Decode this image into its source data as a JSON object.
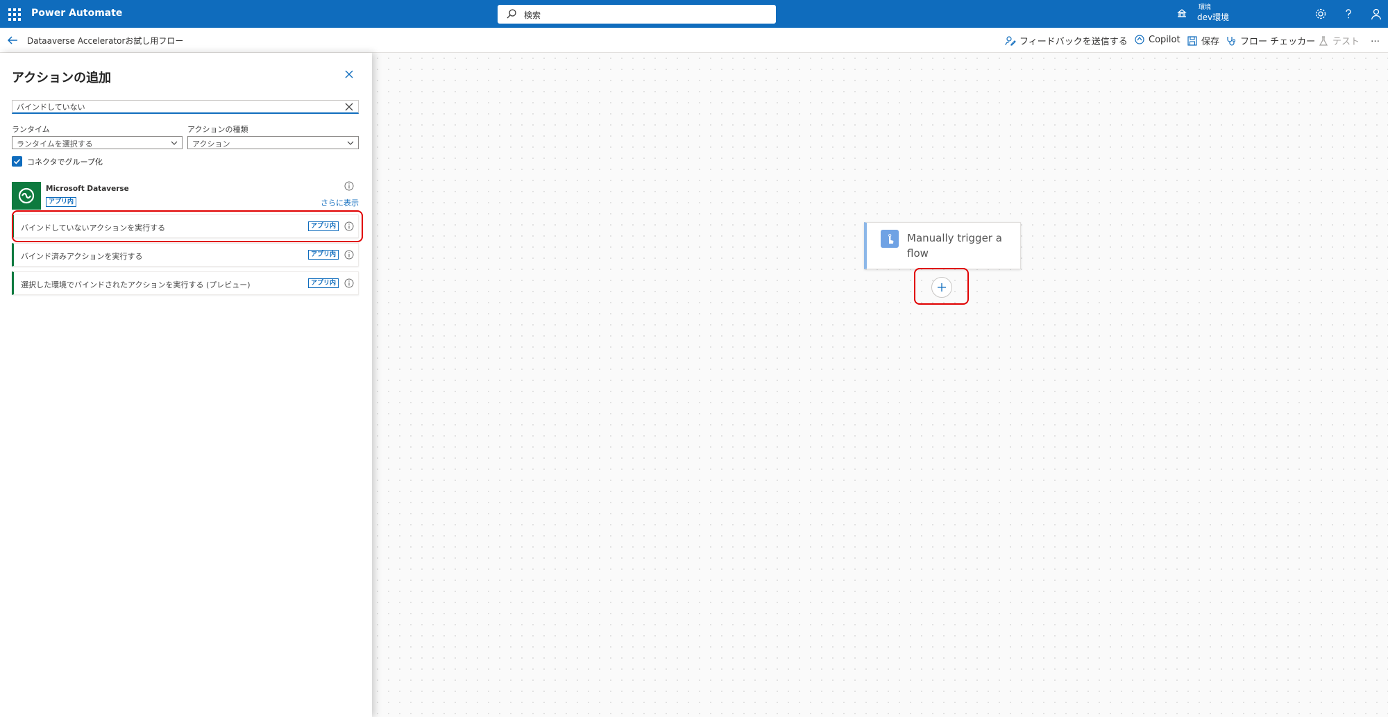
{
  "app": {
    "name": "Power Automate"
  },
  "search": {
    "placeholder": "検索"
  },
  "environment": {
    "label": "環境",
    "name": "dev環境"
  },
  "icons": {
    "waffle": "app-launcher-icon",
    "search": "search-icon",
    "environment": "environment-icon",
    "settings": "gear-icon",
    "help": "help-icon",
    "account": "account-icon"
  },
  "commandbar": {
    "flow_name": "Dataaverse Acceleratorお試し用フロー",
    "feedback": "フィードバックを送信する",
    "copilot": "Copilot",
    "save": "保存",
    "flow_checker": "フロー チェッカー",
    "test": "テスト",
    "more": "…"
  },
  "panel": {
    "title": "アクションの追加",
    "search_value": "バインドしていない",
    "runtime_label": "ランタイム",
    "runtime_value": "ランタイムを選択する",
    "action_type_label": "アクションの種類",
    "action_type_value": "アクション",
    "group_by_connector_label": "コネクタでグループ化",
    "group_by_connector_checked": true,
    "connector": {
      "name": "Microsoft Dataverse",
      "badge": "アプリ内",
      "more": "さらに表示"
    },
    "actions": [
      {
        "name": "バインドしていないアクションを実行する",
        "badge": "アプリ内"
      },
      {
        "name": "バインド済みアクションを実行する",
        "badge": "アプリ内"
      },
      {
        "name": "選択した環境でバインドされたアクションを実行する (プレビュー)",
        "badge": "アプリ内"
      }
    ]
  },
  "canvas": {
    "trigger_name": "Manually trigger a flow"
  },
  "colors": {
    "brand": "#0f6cbd",
    "dataverse": "#0e7a3f",
    "highlight": "#e00000"
  }
}
